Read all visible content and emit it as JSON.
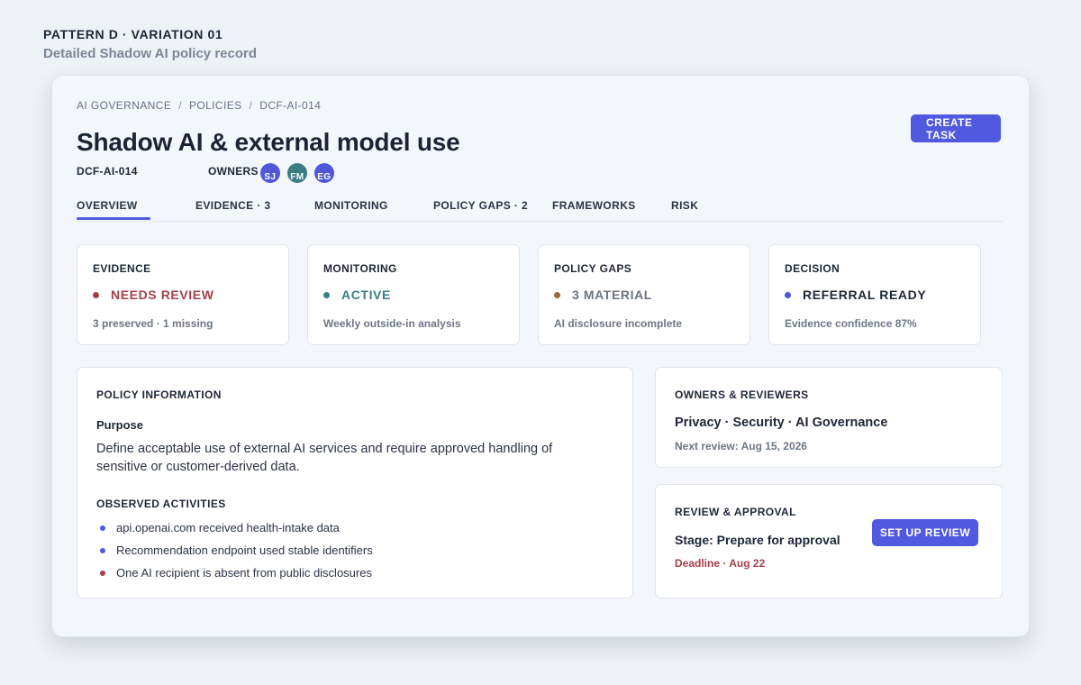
{
  "page": {
    "pattern_label": "PATTERN D · VARIATION 01",
    "pattern_subtitle": "Detailed Shadow AI policy record"
  },
  "breadcrumb": [
    "AI GOVERNANCE",
    "POLICIES",
    "DCF-AI-014"
  ],
  "breadcrumb_separator": "/",
  "policy": {
    "title": "Shadow AI & external model use",
    "id": "DCF-AI-014",
    "owners_label": "OWNERS",
    "owners": [
      "SJ",
      "FM",
      "EG"
    ]
  },
  "actions": {
    "create_task": "CREATE TASK"
  },
  "tabs": [
    {
      "label": "OVERVIEW",
      "active": true
    },
    {
      "label": "EVIDENCE · 3",
      "active": false
    },
    {
      "label": "MONITORING",
      "active": false
    },
    {
      "label": "POLICY GAPS · 2",
      "active": false
    },
    {
      "label": "FRAMEWORKS",
      "active": false
    },
    {
      "label": "RISK",
      "active": false
    }
  ],
  "stats": [
    {
      "label": "EVIDENCE",
      "value": "NEEDS REVIEW",
      "note": "3 preserved · 1 missing",
      "color": "#a5404a"
    },
    {
      "label": "MONITORING",
      "value": "ACTIVE",
      "note": "Weekly outside-in analysis",
      "color": "#3a7d85"
    },
    {
      "label": "POLICY GAPS",
      "value": "3 MATERIAL",
      "note": "AI disclosure incomplete",
      "color": "#9a6a3c"
    },
    {
      "label": "DECISION",
      "value": "REFERRAL READY",
      "note": "Evidence confidence 87%",
      "color": "#4c52d9",
      "value_color": "#1e2738"
    }
  ],
  "policy_information": {
    "heading": "POLICY INFORMATION",
    "purpose_label": "Purpose",
    "purpose_text": "Define acceptable use of external AI services and require approved handling of sensitive or customer-derived data.",
    "observed_heading": "OBSERVED ACTIVITIES",
    "activities": [
      {
        "text": "api.openai.com received health-intake data",
        "color": "#5159e0"
      },
      {
        "text": "Recommendation endpoint used stable identifiers",
        "color": "#5159e0"
      },
      {
        "text": "One AI recipient is absent from public disclosures",
        "color": "#a5404a"
      }
    ]
  },
  "owners_reviewers": {
    "heading": "OWNERS & REVIEWERS",
    "value": "Privacy · Security · AI Governance",
    "next_review": "Next review: Aug 15, 2026"
  },
  "review_approval": {
    "heading": "REVIEW & APPROVAL",
    "stage": "Stage: Prepare for approval",
    "deadline": "Deadline · Aug 22",
    "button": "SET UP REVIEW"
  },
  "colors": {
    "accent": "#5159e0",
    "danger": "#a5404a",
    "teal": "#3a7d85",
    "amber": "#9a6a3c"
  }
}
